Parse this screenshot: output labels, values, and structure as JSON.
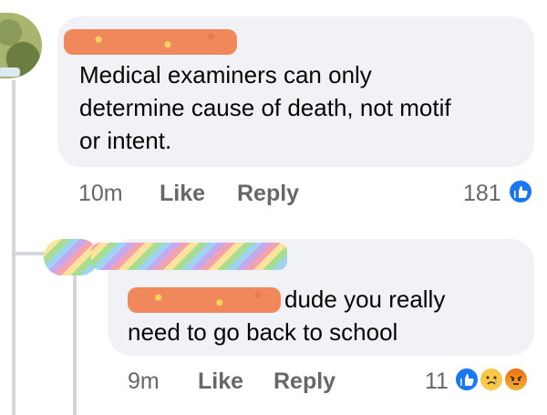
{
  "comments": [
    {
      "text": "Medical examiners can only\ndetermine cause of death, not motif\nor intent.",
      "time": "10m",
      "like_label": "Like",
      "reply_label": "Reply",
      "reaction_count": "181",
      "reactions": [
        "like-icon"
      ]
    },
    {
      "text": "dude you really\nneed to go back to school",
      "time": "9m",
      "like_label": "Like",
      "reply_label": "Reply",
      "reaction_count": "11",
      "reactions": [
        "like-icon",
        "sad-icon",
        "angry-icon"
      ]
    }
  ],
  "colors": {
    "bubble": "#f0f2f5",
    "meta_text": "#65676b",
    "like_blue": "#1877f2",
    "redaction_orange": "#f1885c"
  }
}
